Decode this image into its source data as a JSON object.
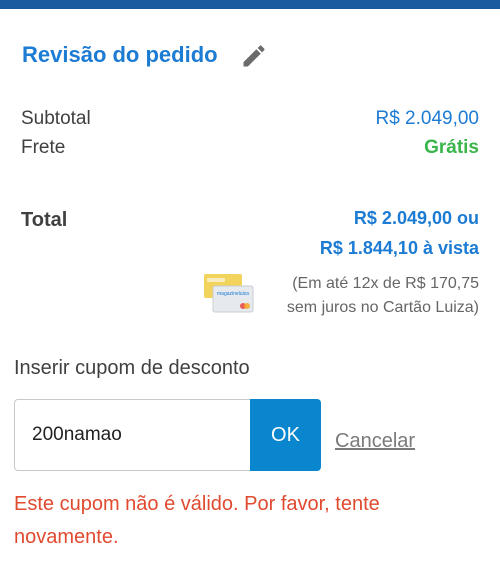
{
  "header": {
    "title": "Revisão do pedido",
    "edit_icon": "pencil-icon"
  },
  "summary": {
    "subtotal_label": "Subtotal",
    "subtotal_value": "R$ 2.049,00",
    "frete_label": "Frete",
    "frete_value": "Grátis"
  },
  "total": {
    "label": "Total",
    "price_line": "R$ 2.049,00 ou",
    "cash_line": "R$ 1.844,10 à vista",
    "installment_line1": "(Em até 12x de R$ 170,75",
    "installment_line2": "sem juros no Cartão Luiza)",
    "cards_icon": "magazine-luiza-cards-icon",
    "card_brand_text": "magazineluiza"
  },
  "coupon": {
    "label": "Inserir cupom de desconto",
    "value": "200namao",
    "ok_label": "OK",
    "cancel_label": "Cancelar",
    "error": "Este cupom não é válido. Por favor, tente novamente."
  },
  "colors": {
    "accent": "#1c7bd3",
    "button": "#0a86ce",
    "success": "#3ab54a",
    "error": "#e04a2f",
    "top_bar": "#1a5a9e"
  }
}
